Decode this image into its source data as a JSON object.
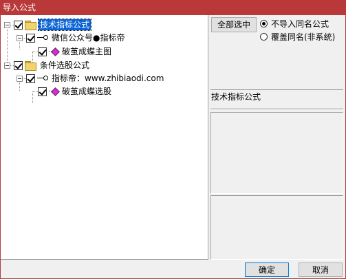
{
  "window": {
    "title": "导入公式"
  },
  "tree": [
    {
      "label": "技术指标公式",
      "type": "folder",
      "checked": true,
      "selected": true
    },
    {
      "label": "微信公众号●指标帝",
      "type": "key",
      "checked": true
    },
    {
      "label": "破茧成蝶主图",
      "type": "formula",
      "checked": true
    },
    {
      "label": "条件选股公式",
      "type": "folder",
      "checked": true
    },
    {
      "label": "指标帝：www.zhibiaodi.com",
      "type": "key",
      "checked": true
    },
    {
      "label": "破茧成蝶选股",
      "type": "formula",
      "checked": true
    }
  ],
  "options": {
    "select_all_label": "全部选中",
    "radio_no_import": "不导入同名公式",
    "radio_overwrite": "覆盖同名(非系统)",
    "selected_radio": "no_import"
  },
  "info": {
    "category_label": "技术指标公式"
  },
  "footer": {
    "ok_label": "确定",
    "cancel_label": "取消"
  },
  "colors": {
    "titlebar": "#b9383a",
    "selection": "#0a64d6",
    "formula_icon": "#cc33cc"
  }
}
